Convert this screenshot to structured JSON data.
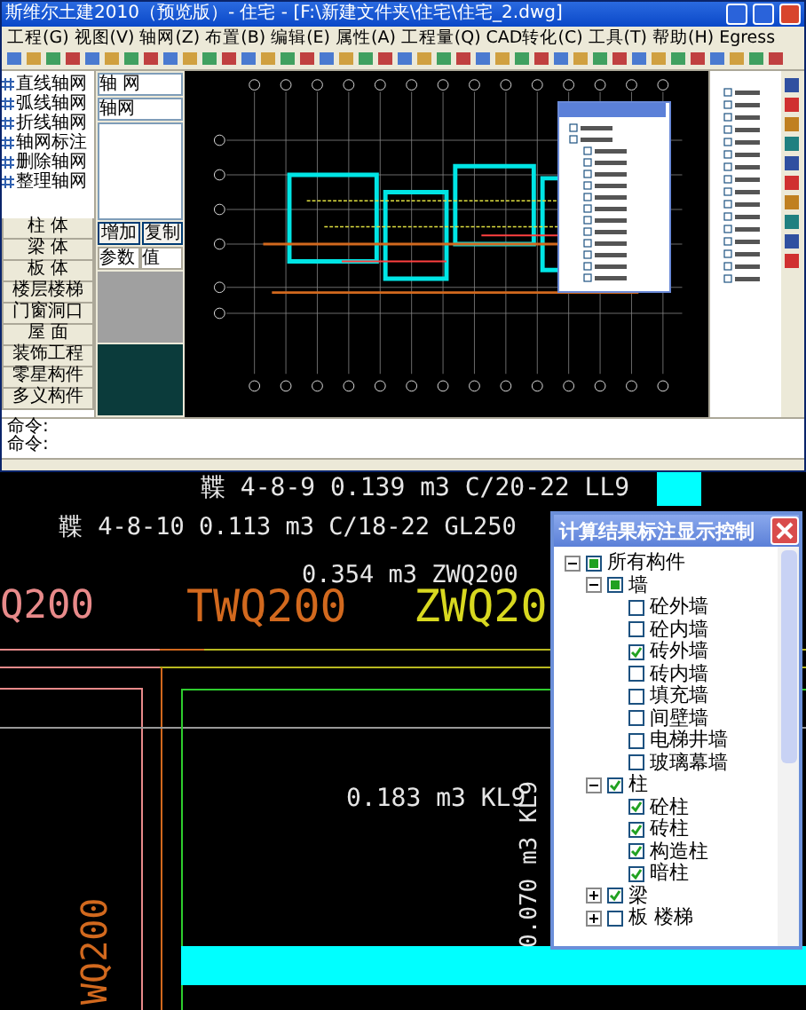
{
  "app_window": {
    "title": "斯维尔土建2010（预览版）- 住宅 - [F:\\新建文件夹\\住宅\\住宅_2.dwg]",
    "menu": [
      "工程(G)",
      "视图(V)",
      "轴网(Z)",
      "布置(B)",
      "编辑(E)",
      "属性(A)",
      "工程量(Q)",
      "CAD转化(C)",
      "工具(T)",
      "帮助(H)",
      "Egress"
    ],
    "tool_list": [
      "直线轴网",
      "弧线轴网",
      "折线轴网",
      "轴网标注",
      "删除轴网",
      "整理轴网"
    ],
    "categories": [
      "柱 体",
      "梁 体",
      "板 体",
      "楼层楼梯",
      "门窗洞口",
      "屋 面",
      "装饰工程",
      "零星构件",
      "多义构件"
    ],
    "property_panel": {
      "fields": [
        "轴 网",
        "轴网"
      ],
      "buttons": [
        "增加",
        "复制"
      ],
      "columns": [
        "参数",
        "值"
      ]
    },
    "command_lines": [
      "命令:",
      "命令:"
    ]
  },
  "cad_view": {
    "labels": [
      {
        "text": "鞢 4-8-9 0.139 m3 C/20-22 LL9",
        "color": "#e6e6e6"
      },
      {
        "text": "鞢 4-8-10 0.113 m3 C/18-22 GL250",
        "color": "#e6e6e6"
      },
      {
        "text": "0.354 m3 ZWQ200",
        "color": "#e6e6e6"
      },
      {
        "text": "Q200",
        "color": "#e88a8a"
      },
      {
        "text": "TWQ200",
        "color": "#d2691e"
      },
      {
        "text": "ZWQ20",
        "color": "#d8d820"
      },
      {
        "text": "0.183 m3 KL9",
        "color": "#e6e6e6"
      },
      {
        "text": "0.070 m3 KL9",
        "color": "#e6e6e6"
      },
      {
        "text": "WQ200",
        "color": "#d2691e"
      }
    ]
  },
  "dialog": {
    "title": "计算结果标注显示控制",
    "tree": [
      {
        "label": "所有构件",
        "checked": false,
        "indeterminate": true,
        "expanded": true,
        "children": [
          {
            "label": "墙",
            "checked": false,
            "indeterminate": true,
            "expanded": true,
            "children": [
              {
                "label": "砼外墙",
                "checked": false
              },
              {
                "label": "砼内墙",
                "checked": false
              },
              {
                "label": "砖外墙",
                "checked": true
              },
              {
                "label": "砖内墙",
                "checked": false
              },
              {
                "label": "填充墙",
                "checked": false
              },
              {
                "label": "间壁墙",
                "checked": false
              },
              {
                "label": "电梯井墙",
                "checked": false
              },
              {
                "label": "玻璃幕墙",
                "checked": false
              }
            ]
          },
          {
            "label": "柱",
            "checked": true,
            "expanded": true,
            "children": [
              {
                "label": "砼柱",
                "checked": true
              },
              {
                "label": "砖柱",
                "checked": true
              },
              {
                "label": "构造柱",
                "checked": true
              },
              {
                "label": "暗柱",
                "checked": true
              }
            ]
          },
          {
            "label": "梁",
            "checked": true,
            "expanded": false
          },
          {
            "label": "板 楼梯",
            "checked": false,
            "expanded": false
          }
        ]
      }
    ]
  }
}
